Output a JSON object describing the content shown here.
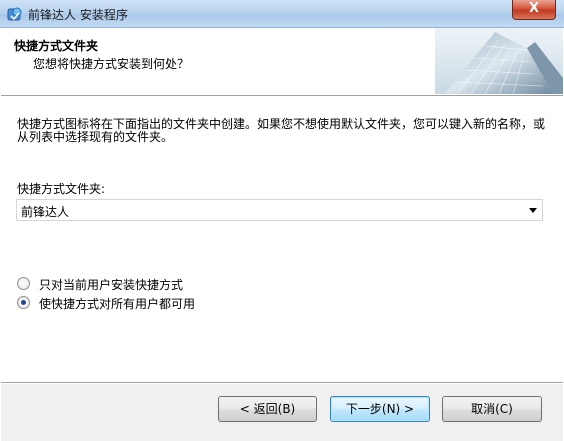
{
  "window": {
    "title": "前锋达人 安装程序",
    "close_label": "X"
  },
  "header": {
    "title": "快捷方式文件夹",
    "subtitle": "您想将快捷方式安装到何处？"
  },
  "body": {
    "description": "快捷方式图标将在下面指出的文件夹中创建。如果您不想使用默认文件夹，您可以键入新的名称，或从列表中选择现有的文件夹。",
    "folder_label": "快捷方式文件夹:",
    "folder_value": "前锋达人",
    "options": [
      {
        "label": "只对当前用户安装快捷方式",
        "checked": false
      },
      {
        "label": "使快捷方式对所有用户都可用",
        "checked": true
      }
    ]
  },
  "buttons": {
    "back": "< 返回(B)",
    "next": "下一步(N) >",
    "cancel": "取消(C)"
  },
  "colors": {
    "titlebar": "#b9d3ee",
    "close_button": "#c33b1f",
    "footer": "#f0f0f0"
  }
}
